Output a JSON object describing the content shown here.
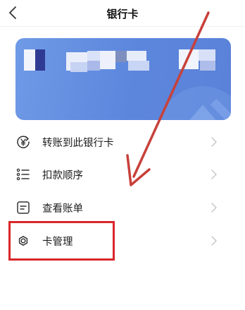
{
  "header": {
    "title": "银行卡",
    "back_icon": "chevron-left-icon"
  },
  "card": {
    "color": "#5f8ade",
    "number_state": "blurred"
  },
  "menu": {
    "items": [
      {
        "label": "转账到此银行卡",
        "icon": "transfer-yen-icon"
      },
      {
        "label": "扣款顺序",
        "icon": "list-order-icon"
      },
      {
        "label": "查看账单",
        "icon": "bill-icon"
      },
      {
        "label": "卡管理",
        "icon": "settings-gear-icon"
      }
    ]
  },
  "annotations": {
    "highlight_color": "#d9262a",
    "highlighted_item": "卡管理"
  }
}
